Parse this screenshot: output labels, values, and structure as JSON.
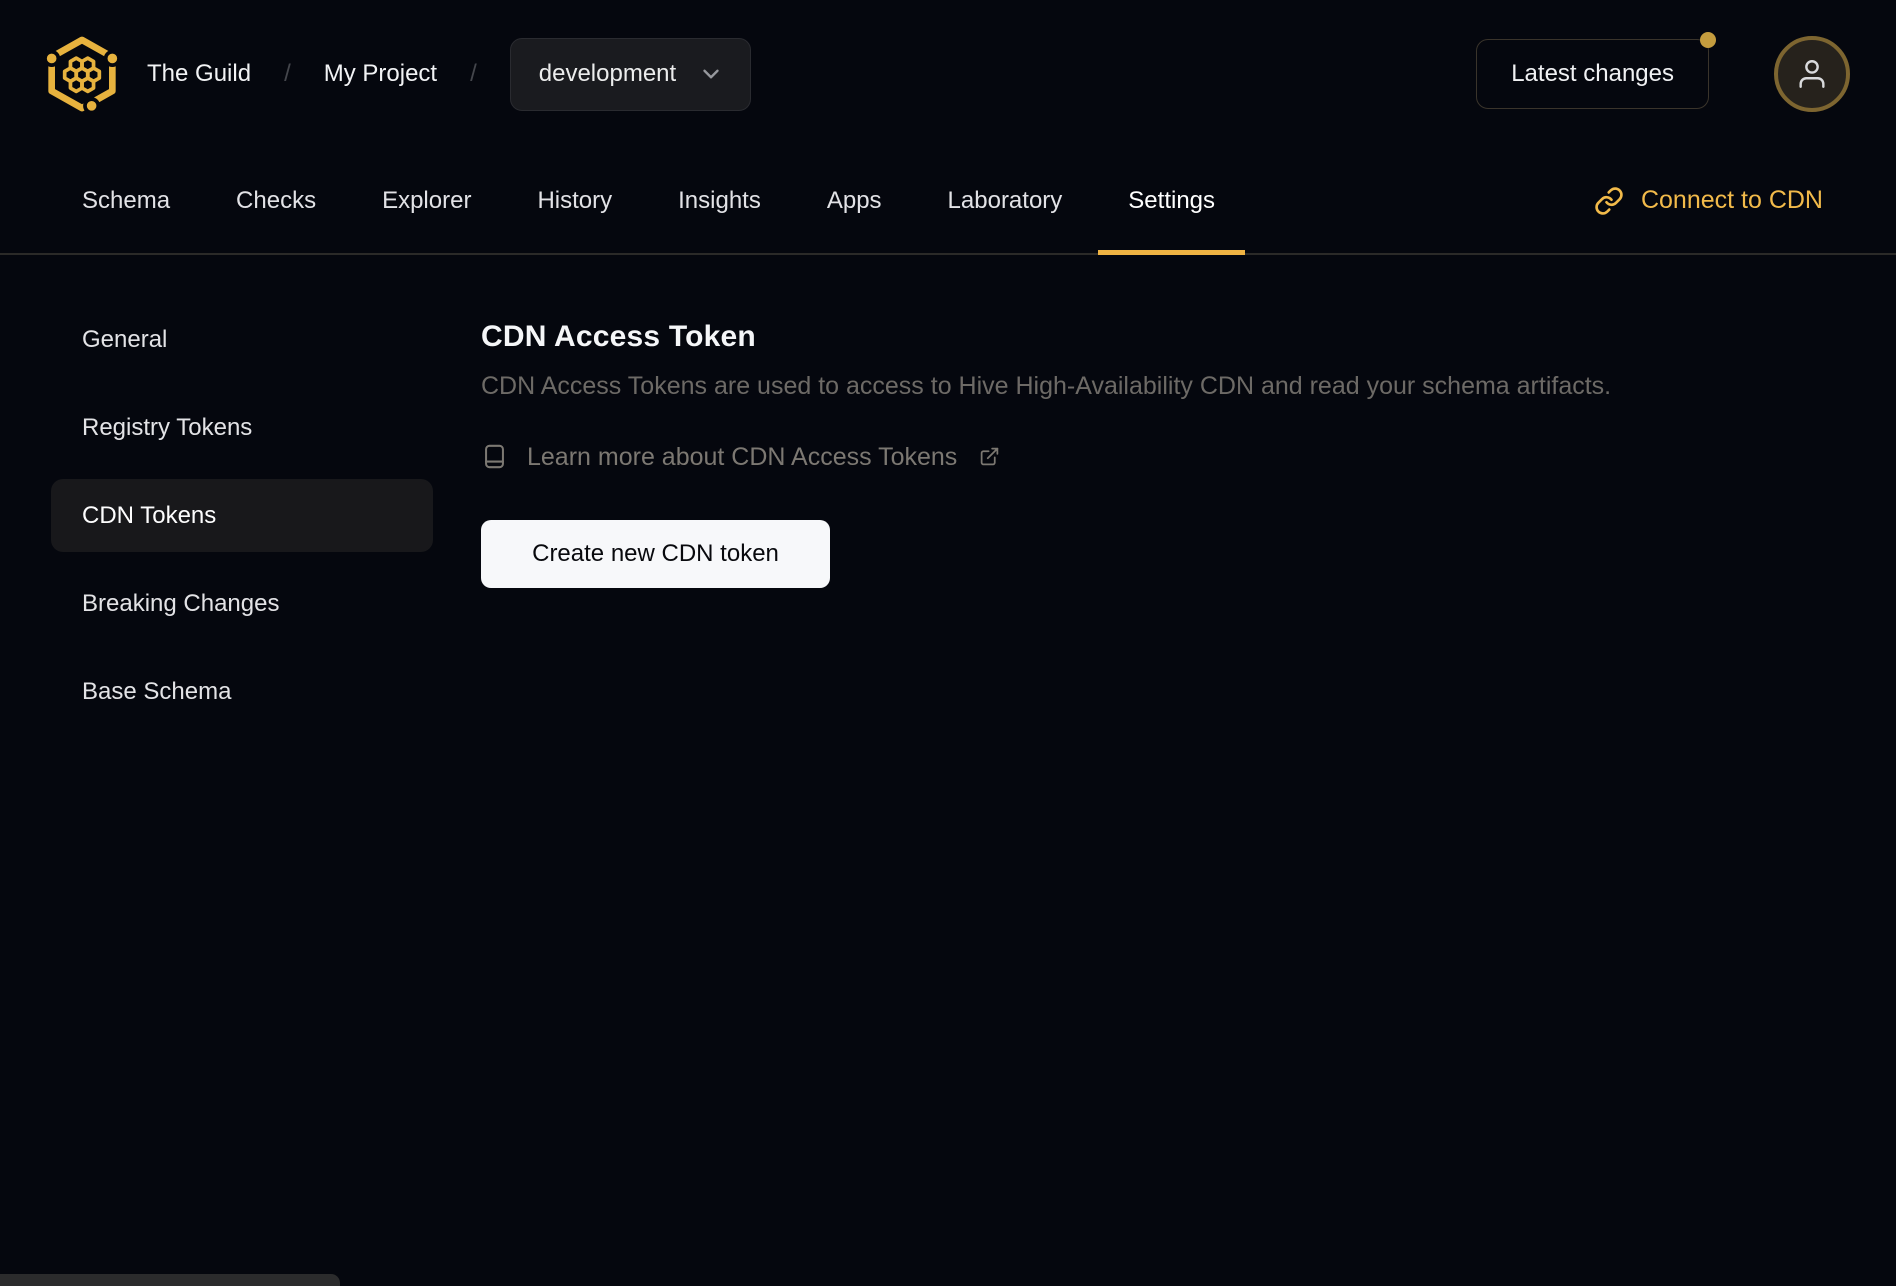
{
  "colors": {
    "page_bg": "#05070e",
    "accent_gold": "#e7b23e",
    "tab_underline": "#efb343",
    "connect_cdn_gold": "#f2ba4a",
    "notification_dot": "#c49c3e",
    "create_button_bg": "#f7f8fa",
    "sidebar_active_bg": "#18181b"
  },
  "icons": {
    "logo": "hive-honeycomb-logo",
    "target_chevron": "chevron-down-icon",
    "avatar": "user-icon",
    "connect_cdn": "link-icon",
    "learn_more": "book-icon",
    "external": "external-link-icon"
  },
  "header": {
    "org": "The Guild",
    "separator": "/",
    "project": "My Project",
    "target_selector": {
      "value": "development"
    },
    "latest_changes_label": "Latest changes"
  },
  "tabs": {
    "items": [
      {
        "label": "Schema"
      },
      {
        "label": "Checks"
      },
      {
        "label": "Explorer"
      },
      {
        "label": "History"
      },
      {
        "label": "Insights"
      },
      {
        "label": "Apps"
      },
      {
        "label": "Laboratory"
      },
      {
        "label": "Settings",
        "active": true
      }
    ],
    "connect_cdn_label": "Connect to CDN"
  },
  "sidebar": {
    "items": [
      {
        "label": "General"
      },
      {
        "label": "Registry Tokens"
      },
      {
        "label": "CDN Tokens",
        "active": true
      },
      {
        "label": "Breaking Changes"
      },
      {
        "label": "Base Schema"
      }
    ]
  },
  "main": {
    "title": "CDN Access Token",
    "description": "CDN Access Tokens are used to access to Hive High-Availability CDN and read your schema artifacts.",
    "learn_more_label": "Learn more about CDN Access Tokens",
    "create_button_label": "Create new CDN token"
  }
}
